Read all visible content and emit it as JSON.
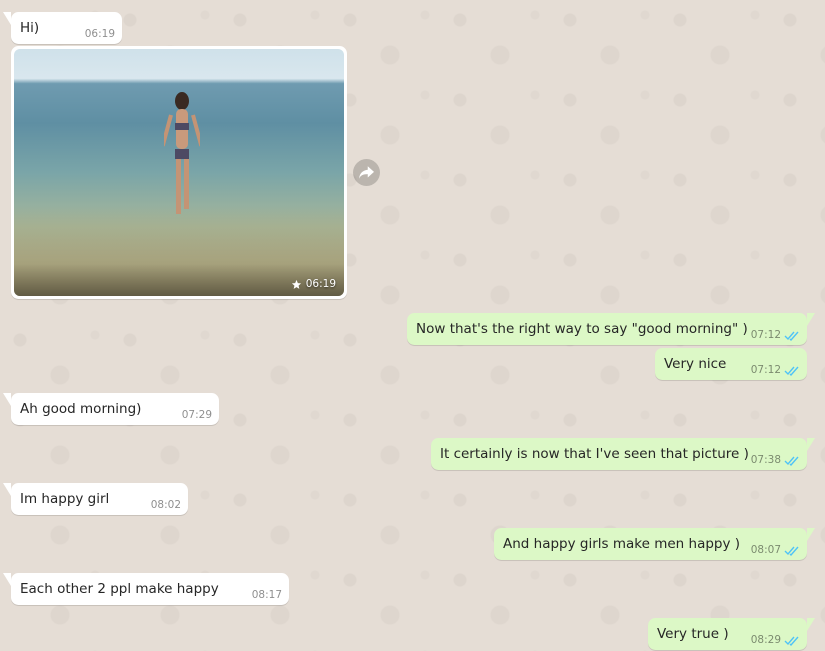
{
  "colors": {
    "wallpaper": "#e5ddd5",
    "incoming_bubble": "#ffffff",
    "outgoing_bubble": "#dcf8c6",
    "read_ticks": "#4fc3f7"
  },
  "messages": [
    {
      "direction": "in",
      "text": "Hi)",
      "time": "06:19"
    },
    {
      "direction": "in",
      "type": "image",
      "image_description_icon": "beach-photo",
      "starred": true,
      "time": "06:19"
    },
    {
      "direction": "out",
      "text": "Now that's the right way to say \"good morning\" )",
      "time": "07:12",
      "status": "read"
    },
    {
      "direction": "out",
      "text": "Very nice",
      "time": "07:12",
      "status": "read"
    },
    {
      "direction": "in",
      "text": "Ah good morning)",
      "time": "07:29"
    },
    {
      "direction": "out",
      "text": "It certainly is now that I've seen that picture )",
      "time": "07:38",
      "status": "read"
    },
    {
      "direction": "in",
      "text": "Im happy girl",
      "time": "08:02"
    },
    {
      "direction": "out",
      "text": "And happy girls make men happy )",
      "time": "08:07",
      "status": "read"
    },
    {
      "direction": "in",
      "text": "Each other 2 ppl make happy",
      "time": "08:17"
    },
    {
      "direction": "out",
      "text": "Very true )",
      "time": "08:29",
      "status": "read"
    }
  ],
  "icons": {
    "forward": "forward-icon",
    "star": "star-icon",
    "ticks": "double-check-icon"
  }
}
